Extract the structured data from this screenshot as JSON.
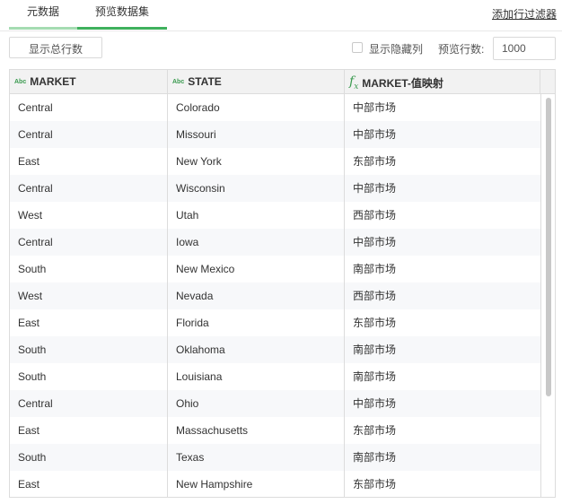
{
  "tabs": [
    {
      "label": "元数据",
      "active": false
    },
    {
      "label": "预览数据集",
      "active": true
    }
  ],
  "filter_link": "添加行过滤器",
  "toolbar": {
    "show_total_label": "显示总行数",
    "show_hidden_label": "显示隐藏列",
    "show_hidden_checked": false,
    "preview_rows_label": "预览行数:",
    "preview_rows_value": "1000"
  },
  "table": {
    "columns": [
      {
        "type_icon": "Abc",
        "label": "MARKET"
      },
      {
        "type_icon": "Abc",
        "label": "STATE"
      },
      {
        "type_icon": "fx",
        "label": "MARKET-值映射"
      }
    ],
    "rows": [
      [
        "Central",
        "Colorado",
        "中部市场"
      ],
      [
        "Central",
        "Missouri",
        "中部市场"
      ],
      [
        "East",
        "New York",
        "东部市场"
      ],
      [
        "Central",
        "Wisconsin",
        "中部市场"
      ],
      [
        "West",
        "Utah",
        "西部市场"
      ],
      [
        "Central",
        "Iowa",
        "中部市场"
      ],
      [
        "South",
        "New Mexico",
        "南部市场"
      ],
      [
        "West",
        "Nevada",
        "西部市场"
      ],
      [
        "East",
        "Florida",
        "东部市场"
      ],
      [
        "South",
        "Oklahoma",
        "南部市场"
      ],
      [
        "South",
        "Louisiana",
        "南部市场"
      ],
      [
        "Central",
        "Ohio",
        "中部市场"
      ],
      [
        "East",
        "Massachusetts",
        "东部市场"
      ],
      [
        "South",
        "Texas",
        "南部市场"
      ],
      [
        "East",
        "New Hampshire",
        "东部市场"
      ]
    ]
  },
  "colors": {
    "accent": "#3fb15d",
    "accent_light": "#a5dcb2",
    "header_bg": "#f2f2f2",
    "row_alt_bg": "#f7f8fa"
  }
}
